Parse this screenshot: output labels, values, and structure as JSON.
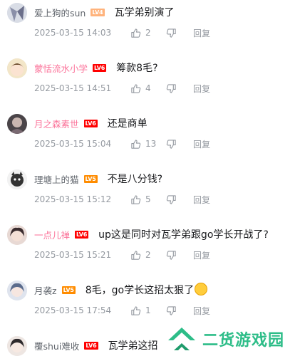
{
  "comments": [
    {
      "user": "爱上狗的sun",
      "level": "LV4",
      "text": "瓦学弟别演了",
      "time": "2025-03-15 14:03",
      "likes": "2",
      "reply": "回复",
      "vip": false
    },
    {
      "user": "蒙恬流水小学",
      "level": "LV6",
      "text": "筹款8毛?",
      "time": "2025-03-15 14:51",
      "likes": "4",
      "reply": "回复",
      "vip": true
    },
    {
      "user": "月之森素世",
      "level": "LV6",
      "text": "还是商单",
      "time": "2025-03-15 15:04",
      "likes": "13",
      "reply": "回复",
      "vip": true
    },
    {
      "user": "理塘上的猫",
      "level": "LV5",
      "text": "不是八分钱?",
      "time": "2025-03-15 15:12",
      "likes": "5",
      "reply": "回复",
      "vip": false
    },
    {
      "user": "一点儿禅",
      "level": "LV6",
      "text": "up这是同时对瓦学弟跟go学长开战了?",
      "time": "2025-03-15 15:21",
      "likes": "2",
      "reply": "回复",
      "vip": true
    },
    {
      "user": "月袭z",
      "level": "LV5",
      "text": "8毛，go学长这招太狠了",
      "time": "2025-03-15 17:54",
      "likes": "1",
      "reply": "回复",
      "vip": false
    },
    {
      "user": "覆shui难收",
      "level": "LV6",
      "text": "瓦学弟这招",
      "time": "",
      "likes": "",
      "reply": "",
      "vip": false
    }
  ],
  "watermark": {
    "text": "二货游戏园",
    "color": "#2dbd88"
  },
  "colors": {
    "vip_name": "#fb7299",
    "meta": "#9499a0",
    "lv4": "#ffb37c",
    "lv5": "#ff8c00",
    "lv6": "#ff0000"
  }
}
